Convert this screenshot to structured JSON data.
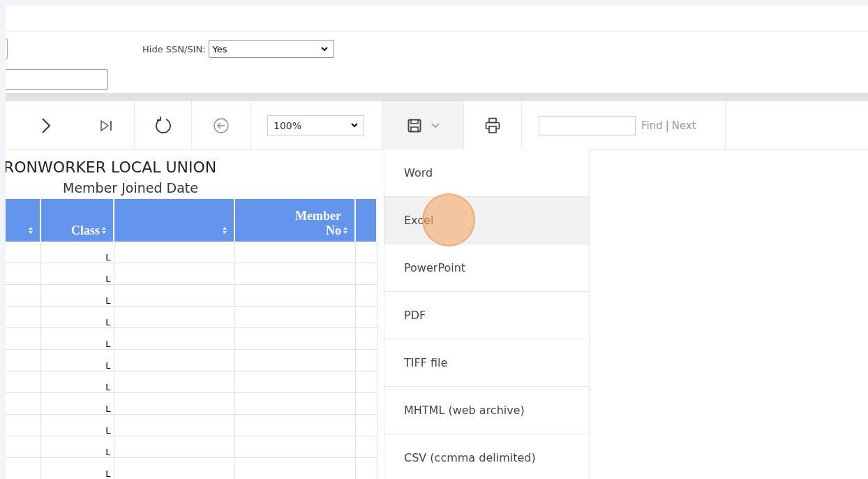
{
  "parameters": {
    "hide_ssn_label": "Hide SSN/SIN:",
    "hide_ssn_value": "Yes"
  },
  "toolbar": {
    "zoom": "100%",
    "find": "Find",
    "separator": "|",
    "next": "Next"
  },
  "report": {
    "title": "RONWORKER LOCAL UNION",
    "subtitle": "Member Joined Date"
  },
  "table": {
    "columns": [
      {
        "sortable": true
      },
      {
        "label": "Class",
        "sortable": true
      },
      {
        "sortable": true
      },
      {
        "label": "Member No",
        "sortable": true
      },
      {
        "sortable": false
      }
    ],
    "rows": [
      {
        "class": "L"
      },
      {
        "class": "L"
      },
      {
        "class": "L"
      },
      {
        "class": "L"
      },
      {
        "class": "L"
      },
      {
        "class": "L"
      },
      {
        "class": "L"
      },
      {
        "class": "L"
      },
      {
        "class": "L"
      },
      {
        "class": "L"
      },
      {
        "class": "L"
      }
    ]
  },
  "export_menu": [
    {
      "label": "Word",
      "selected": false
    },
    {
      "label": "Excel",
      "selected": true
    },
    {
      "label": "PowerPoint",
      "selected": false
    },
    {
      "label": "PDF",
      "selected": false
    },
    {
      "label": "TIFF file",
      "selected": false
    },
    {
      "label": "MHTML (web archive)",
      "selected": false
    },
    {
      "label": "CSV (ccmma delimited)",
      "selected": false
    }
  ]
}
